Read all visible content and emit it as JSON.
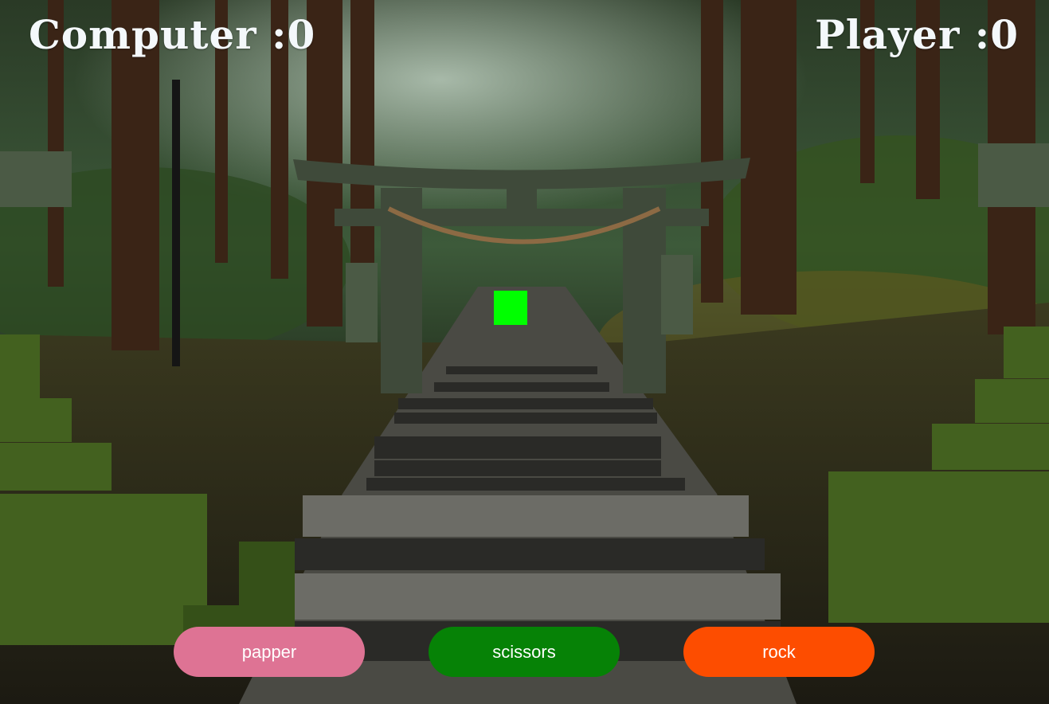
{
  "scores": {
    "computer_label": "Computer",
    "computer_value": "0",
    "player_label": "Player",
    "player_value": "0",
    "separator": " :"
  },
  "status_box": {
    "color": "#00ff00"
  },
  "choices": [
    {
      "id": "papper",
      "label": "papper",
      "color": "#de7394"
    },
    {
      "id": "scissors",
      "label": "scissors",
      "color": "#068206"
    },
    {
      "id": "rock",
      "label": "rock",
      "color": "#fd4d00"
    }
  ]
}
